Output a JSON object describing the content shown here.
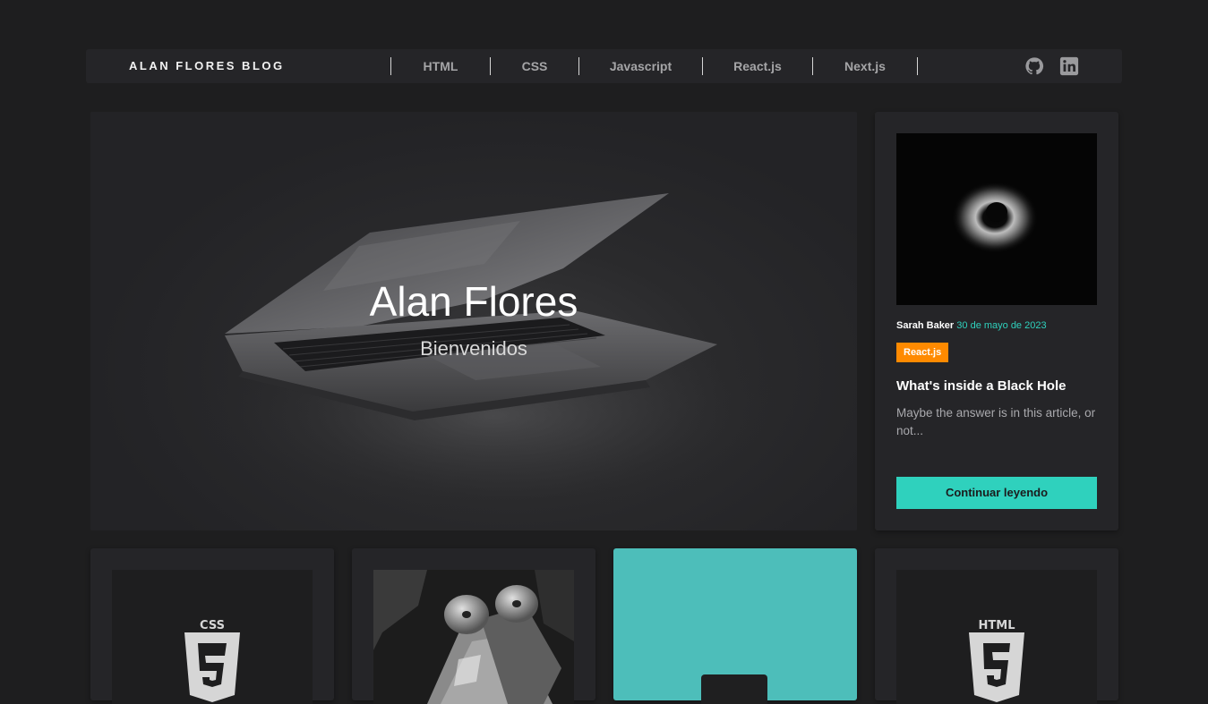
{
  "nav": {
    "brand": "ALAN FLORES BLOG",
    "links": [
      "HTML",
      "CSS",
      "Javascript",
      "React.js",
      "Next.js"
    ],
    "social_icons": [
      "github-icon",
      "linkedin-icon"
    ]
  },
  "hero": {
    "title": "Alan Flores",
    "subtitle": "Bienvenidos"
  },
  "featured_post": {
    "author": "Sarah Baker",
    "date": "30 de mayo de 2023",
    "tag": "React.js",
    "tag_color": "#ff8a00",
    "title": "What's inside a Black Hole",
    "description": "Maybe the answer is in this article, or not...",
    "button_label": "Continuar leyendo"
  },
  "post_cards": [
    {
      "image": "css3-logo",
      "logo_text": "CSS"
    },
    {
      "image": "mantis-shrimp-photo"
    },
    {
      "image": "teal-card"
    },
    {
      "image": "html5-logo",
      "logo_text": "HTML"
    }
  ],
  "colors": {
    "background": "#1e1e1f",
    "surface": "#252528",
    "accent": "#2fd1bd",
    "teal_card": "#4dbeba",
    "tag": "#ff8a00"
  }
}
